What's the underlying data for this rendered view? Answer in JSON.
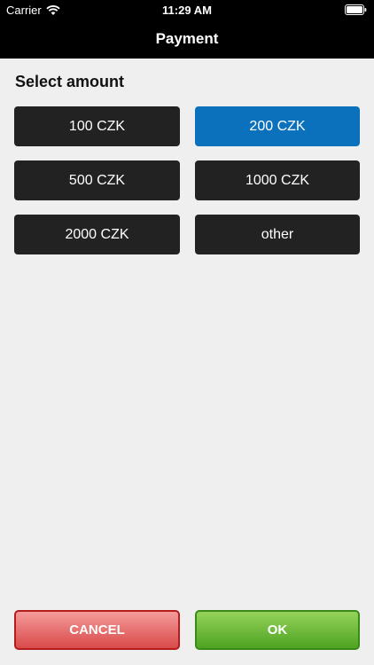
{
  "status_bar": {
    "carrier": "Carrier",
    "time": "11:29 AM",
    "icons": [
      "wifi-icon",
      "battery-icon"
    ]
  },
  "nav": {
    "title": "Payment"
  },
  "main": {
    "section_title": "Select amount",
    "amounts": [
      {
        "label": "100 CZK",
        "selected": false
      },
      {
        "label": "200 CZK",
        "selected": true
      },
      {
        "label": "500 CZK",
        "selected": false
      },
      {
        "label": "1000 CZK",
        "selected": false
      },
      {
        "label": "2000 CZK",
        "selected": false
      },
      {
        "label": "other",
        "selected": false
      }
    ]
  },
  "actions": {
    "cancel_label": "CANCEL",
    "ok_label": "OK"
  },
  "colors": {
    "selected": "#0c71bd",
    "unselected": "#222222",
    "cancel": "#d94a4a",
    "ok": "#4ea322",
    "background": "#efefef"
  }
}
